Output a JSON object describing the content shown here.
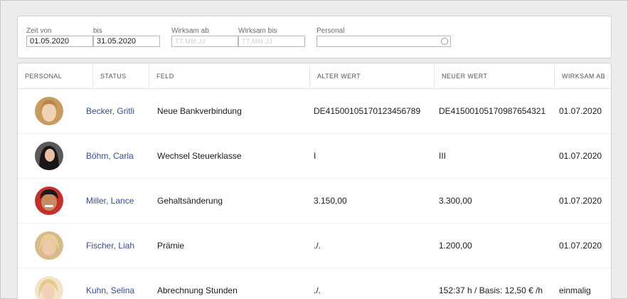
{
  "filters": {
    "zeit_von": {
      "label": "Zeit von",
      "value": "01.05.2020"
    },
    "bis": {
      "label": "bis",
      "value": "31.05.2020"
    },
    "wirksam_ab": {
      "label": "Wirksam ab",
      "placeholder": "TT.MM.JJ"
    },
    "wirksam_bis": {
      "label": "Wirksam bis",
      "placeholder": "TT.MM.JJ"
    },
    "personal": {
      "label": "Personal",
      "value": ""
    }
  },
  "table": {
    "headers": [
      "PERSONAL",
      "STATUS",
      "FELD",
      "ALTER WERT",
      "NEUER WERT",
      "WIRKSAM AB"
    ],
    "rows": [
      {
        "name": "Becker, Gritli",
        "feld": "Neue Bankverbindung",
        "alter_wert": "DE41500105170123456789",
        "neuer_wert": "DE41500105170987654321",
        "wirksam_ab": "01.07.2020",
        "avatar_color": "#d9b77a"
      },
      {
        "name": "Böhm, Carla",
        "feld": "Wechsel Steuerklasse",
        "alter_wert": "I",
        "neuer_wert": "III",
        "wirksam_ab": "01.07.2020",
        "avatar_color": "#2a2323"
      },
      {
        "name": "Miller, Lance",
        "feld": "Gehaltsänderung",
        "alter_wert": "3.150,00",
        "neuer_wert": "3.300,00",
        "wirksam_ab": "01.07.2020",
        "avatar_color": "#b23a2c"
      },
      {
        "name": "Fischer, Liah",
        "feld": "Prämie",
        "alter_wert": "./.",
        "neuer_wert": "1.200,00",
        "wirksam_ab": "01.07.2020",
        "avatar_color": "#e0c79a"
      },
      {
        "name": "Kuhn, Selina",
        "feld": "Abrechnung Stunden",
        "alter_wert": "./.",
        "neuer_wert": "152:37 h / Basis: 12,50 € /h",
        "wirksam_ab": "einmalig",
        "avatar_color": "#e6d2a8"
      }
    ]
  }
}
